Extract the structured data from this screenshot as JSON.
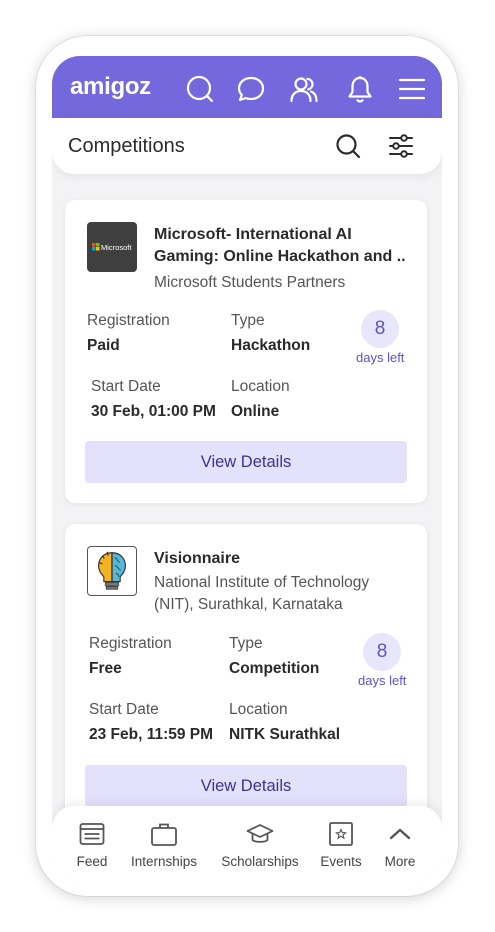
{
  "app": {
    "logo": "amigoz"
  },
  "header": {
    "title": "Competitions"
  },
  "cards": [
    {
      "logo_text": "Microsoft",
      "title_line1": "Microsoft- International AI",
      "title_line2": "Gaming: Online Hackathon and ..",
      "org_line1": "Microsoft Students Partners",
      "org_line2": "",
      "registration_label": "Registration",
      "registration_value": "Paid",
      "type_label": "Type",
      "type_value": "Hackathon",
      "days": "8",
      "days_label": "days left",
      "start_label": "Start Date",
      "start_value": "30 Feb, 01:00 PM",
      "location_label": "Location",
      "location_value": "Online",
      "button": "View Details"
    },
    {
      "logo_text": "",
      "title_line1": "Visionnaire",
      "title_line2": "",
      "org_line1": "National Institute of Technology",
      "org_line2": "(NIT), Surathkal, Karnataka",
      "registration_label": "Registration",
      "registration_value": "Free",
      "type_label": "Type",
      "type_value": "Competition",
      "days": "8",
      "days_label": "days left",
      "start_label": "Start Date",
      "start_value": "23 Feb, 11:59 PM",
      "location_label": "Location",
      "location_value": "NITK Surathkal",
      "button": "View Details"
    }
  ],
  "nav": [
    {
      "label": "Feed",
      "icon": "feed-icon"
    },
    {
      "label": "Internships",
      "icon": "briefcase-icon"
    },
    {
      "label": "Scholarships",
      "icon": "graduation-cap-icon"
    },
    {
      "label": "Events",
      "icon": "event-star-icon"
    },
    {
      "label": "More",
      "icon": "chevron-up-icon"
    }
  ],
  "colors": {
    "brand": "#7468dc",
    "accent_light": "#e3e1fb",
    "accent_text": "#5d52c9"
  }
}
